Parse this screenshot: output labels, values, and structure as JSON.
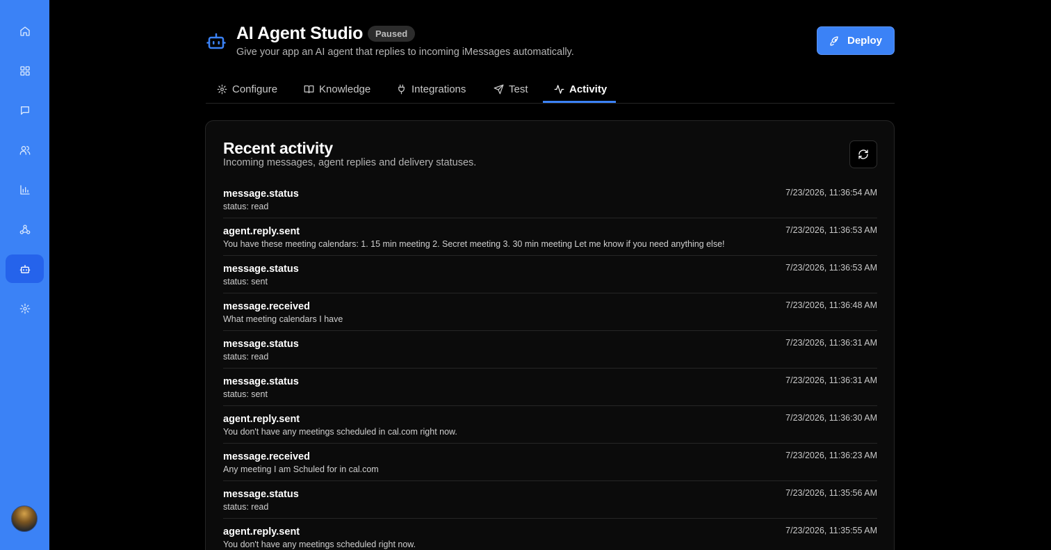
{
  "sidebar": {
    "items": [
      {
        "icon": "home-icon",
        "active": false
      },
      {
        "icon": "dashboard-icon",
        "active": false
      },
      {
        "icon": "message-icon",
        "active": false
      },
      {
        "icon": "users-icon",
        "active": false
      },
      {
        "icon": "chart-icon",
        "active": false
      },
      {
        "icon": "webhook-icon",
        "active": false
      },
      {
        "icon": "bot-icon",
        "active": true
      },
      {
        "icon": "gear-icon",
        "active": false
      }
    ]
  },
  "header": {
    "title": "AI Agent Studio",
    "status": "Paused",
    "subtitle": "Give your app an AI agent that replies to incoming iMessages automatically.",
    "deploy_label": "Deploy"
  },
  "tabs": [
    {
      "label": "Configure",
      "icon": "gear-icon",
      "active": false
    },
    {
      "label": "Knowledge",
      "icon": "book-icon",
      "active": false
    },
    {
      "label": "Integrations",
      "icon": "plug-icon",
      "active": false
    },
    {
      "label": "Test",
      "icon": "send-icon",
      "active": false
    },
    {
      "label": "Activity",
      "icon": "activity-icon",
      "active": true
    }
  ],
  "activity": {
    "title": "Recent activity",
    "subtitle": "Incoming messages, agent replies and delivery statuses.",
    "items": [
      {
        "type": "message.status",
        "detail": "status: read",
        "time": "7/23/2026, 11:36:54 AM"
      },
      {
        "type": "agent.reply.sent",
        "detail": "You have these meeting calendars: 1. 15 min meeting 2. Secret meeting 3. 30 min meeting Let me know if you need anything else!",
        "time": "7/23/2026, 11:36:53 AM"
      },
      {
        "type": "message.status",
        "detail": "status: sent",
        "time": "7/23/2026, 11:36:53 AM"
      },
      {
        "type": "message.received",
        "detail": "What meeting calendars I have",
        "time": "7/23/2026, 11:36:48 AM"
      },
      {
        "type": "message.status",
        "detail": "status: read",
        "time": "7/23/2026, 11:36:31 AM"
      },
      {
        "type": "message.status",
        "detail": "status: sent",
        "time": "7/23/2026, 11:36:31 AM"
      },
      {
        "type": "agent.reply.sent",
        "detail": "You don't have any meetings scheduled in cal.com right now.",
        "time": "7/23/2026, 11:36:30 AM"
      },
      {
        "type": "message.received",
        "detail": "Any meeting I am Schuled for in cal.com",
        "time": "7/23/2026, 11:36:23 AM"
      },
      {
        "type": "message.status",
        "detail": "status: read",
        "time": "7/23/2026, 11:35:56 AM"
      },
      {
        "type": "agent.reply.sent",
        "detail": "You don't have any meetings scheduled right now.",
        "time": "7/23/2026, 11:35:55 AM"
      }
    ]
  },
  "colors": {
    "accent": "#3b82f6",
    "background": "#000000",
    "card": "#0b0b0b"
  }
}
